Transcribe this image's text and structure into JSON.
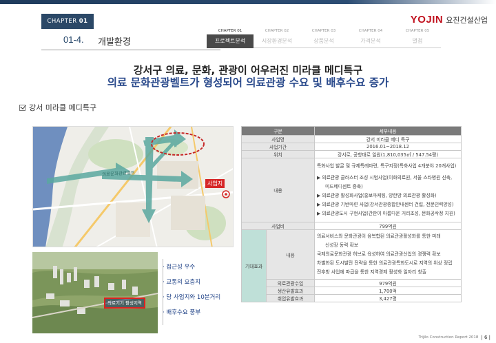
{
  "header": {
    "chapter_tab": "CHAPTER",
    "chapter_num": "01",
    "section_no": "01-4.",
    "section_title": "개발환경",
    "logo_brand": "YOJIN",
    "logo_kr": "요진건설산업"
  },
  "nav": [
    {
      "cap": "CHAPTER 01",
      "label": "프로젝트분석",
      "active": true
    },
    {
      "cap": "CHAPTER 02",
      "label": "시장환경분석",
      "active": false
    },
    {
      "cap": "CHAPTER 03",
      "label": "상품분석",
      "active": false
    },
    {
      "cap": "CHAPTER 04",
      "label": "가격분석",
      "active": false
    },
    {
      "cap": "CHAPTER 05",
      "label": "별첨",
      "active": false
    }
  ],
  "headline": {
    "line1": "강서구 의료, 문화, 관광이 어우러진 미라클 메디특구",
    "line2": "의료 문화관광벨트가 형성되어 의료관광 수요 및 배후수요 증가"
  },
  "subheader": "강서 미라클 메디특구",
  "map": {
    "site_tag": "사업지",
    "belt_label": "의료문화관광벨트"
  },
  "photo": {
    "label": "의료기기 활성지역"
  },
  "features": [
    "· 접근성 우수",
    "· 교통의 요충지",
    "· 당 사업지와 10분거리",
    "· 배후수요 풍부"
  ],
  "table": {
    "head_k": "구분",
    "head_v": "세부내용",
    "rows": [
      {
        "k": "사업명",
        "v": "강서 미라클 메디 특구"
      },
      {
        "k": "사업기간",
        "v": "2016.01~2018.12"
      },
      {
        "k": "위치",
        "v": "강서로, 공항대로 일원(1,810,035㎡ / 547.54평)"
      }
    ],
    "content_k": "내용",
    "content_lines": [
      "특화사업 발굴 및 규제특례마련, 특구지정(특화사업 4개분야 20개사업)",
      "▶ 의료관광 클러스터 조성 시범사업(이화의료원, 서울 스타병원 신축,",
      "미드메디센트 증축)",
      "▶ 의료관광 활성화사업(홍보마케팅, 양한방 의료관광 활성화)",
      "▶ 의료관광 기반마련 사업(강서관광종합안내센터 건립, 전문인력양성)",
      "▶ 의료관광도시 구현사업(간판이 아름다운 거리조성, 문화공삭정 지원)"
    ],
    "budget_k": "사업비",
    "budget_v": "799억원",
    "effect_k": "기대효과",
    "effect_sub": "내용",
    "effect_lines": [
      "의료서비스와 문화관광이 융복합된 의료관광활성화를 통한 미래",
      "신성장 동력 확보",
      "국제의료문화관광 허브로 육성하여 의료관광산업의 경쟁력 확보",
      "차별화된 도시발전 전략을 통한 의료관광특화도시로 지역의 위상 정립",
      "전후방 사업에 파급을 통한 지역경제 활성화 일자리 창출"
    ],
    "effect_rows": [
      {
        "k": "의료관광수입",
        "v": "979억원"
      },
      {
        "k": "생산유발효과",
        "v": "1,700억"
      },
      {
        "k": "취업유발효과",
        "v": "3,427명"
      }
    ]
  },
  "footer": {
    "report": "Trijilo Construction Report 2018",
    "page": "| 6 |"
  }
}
